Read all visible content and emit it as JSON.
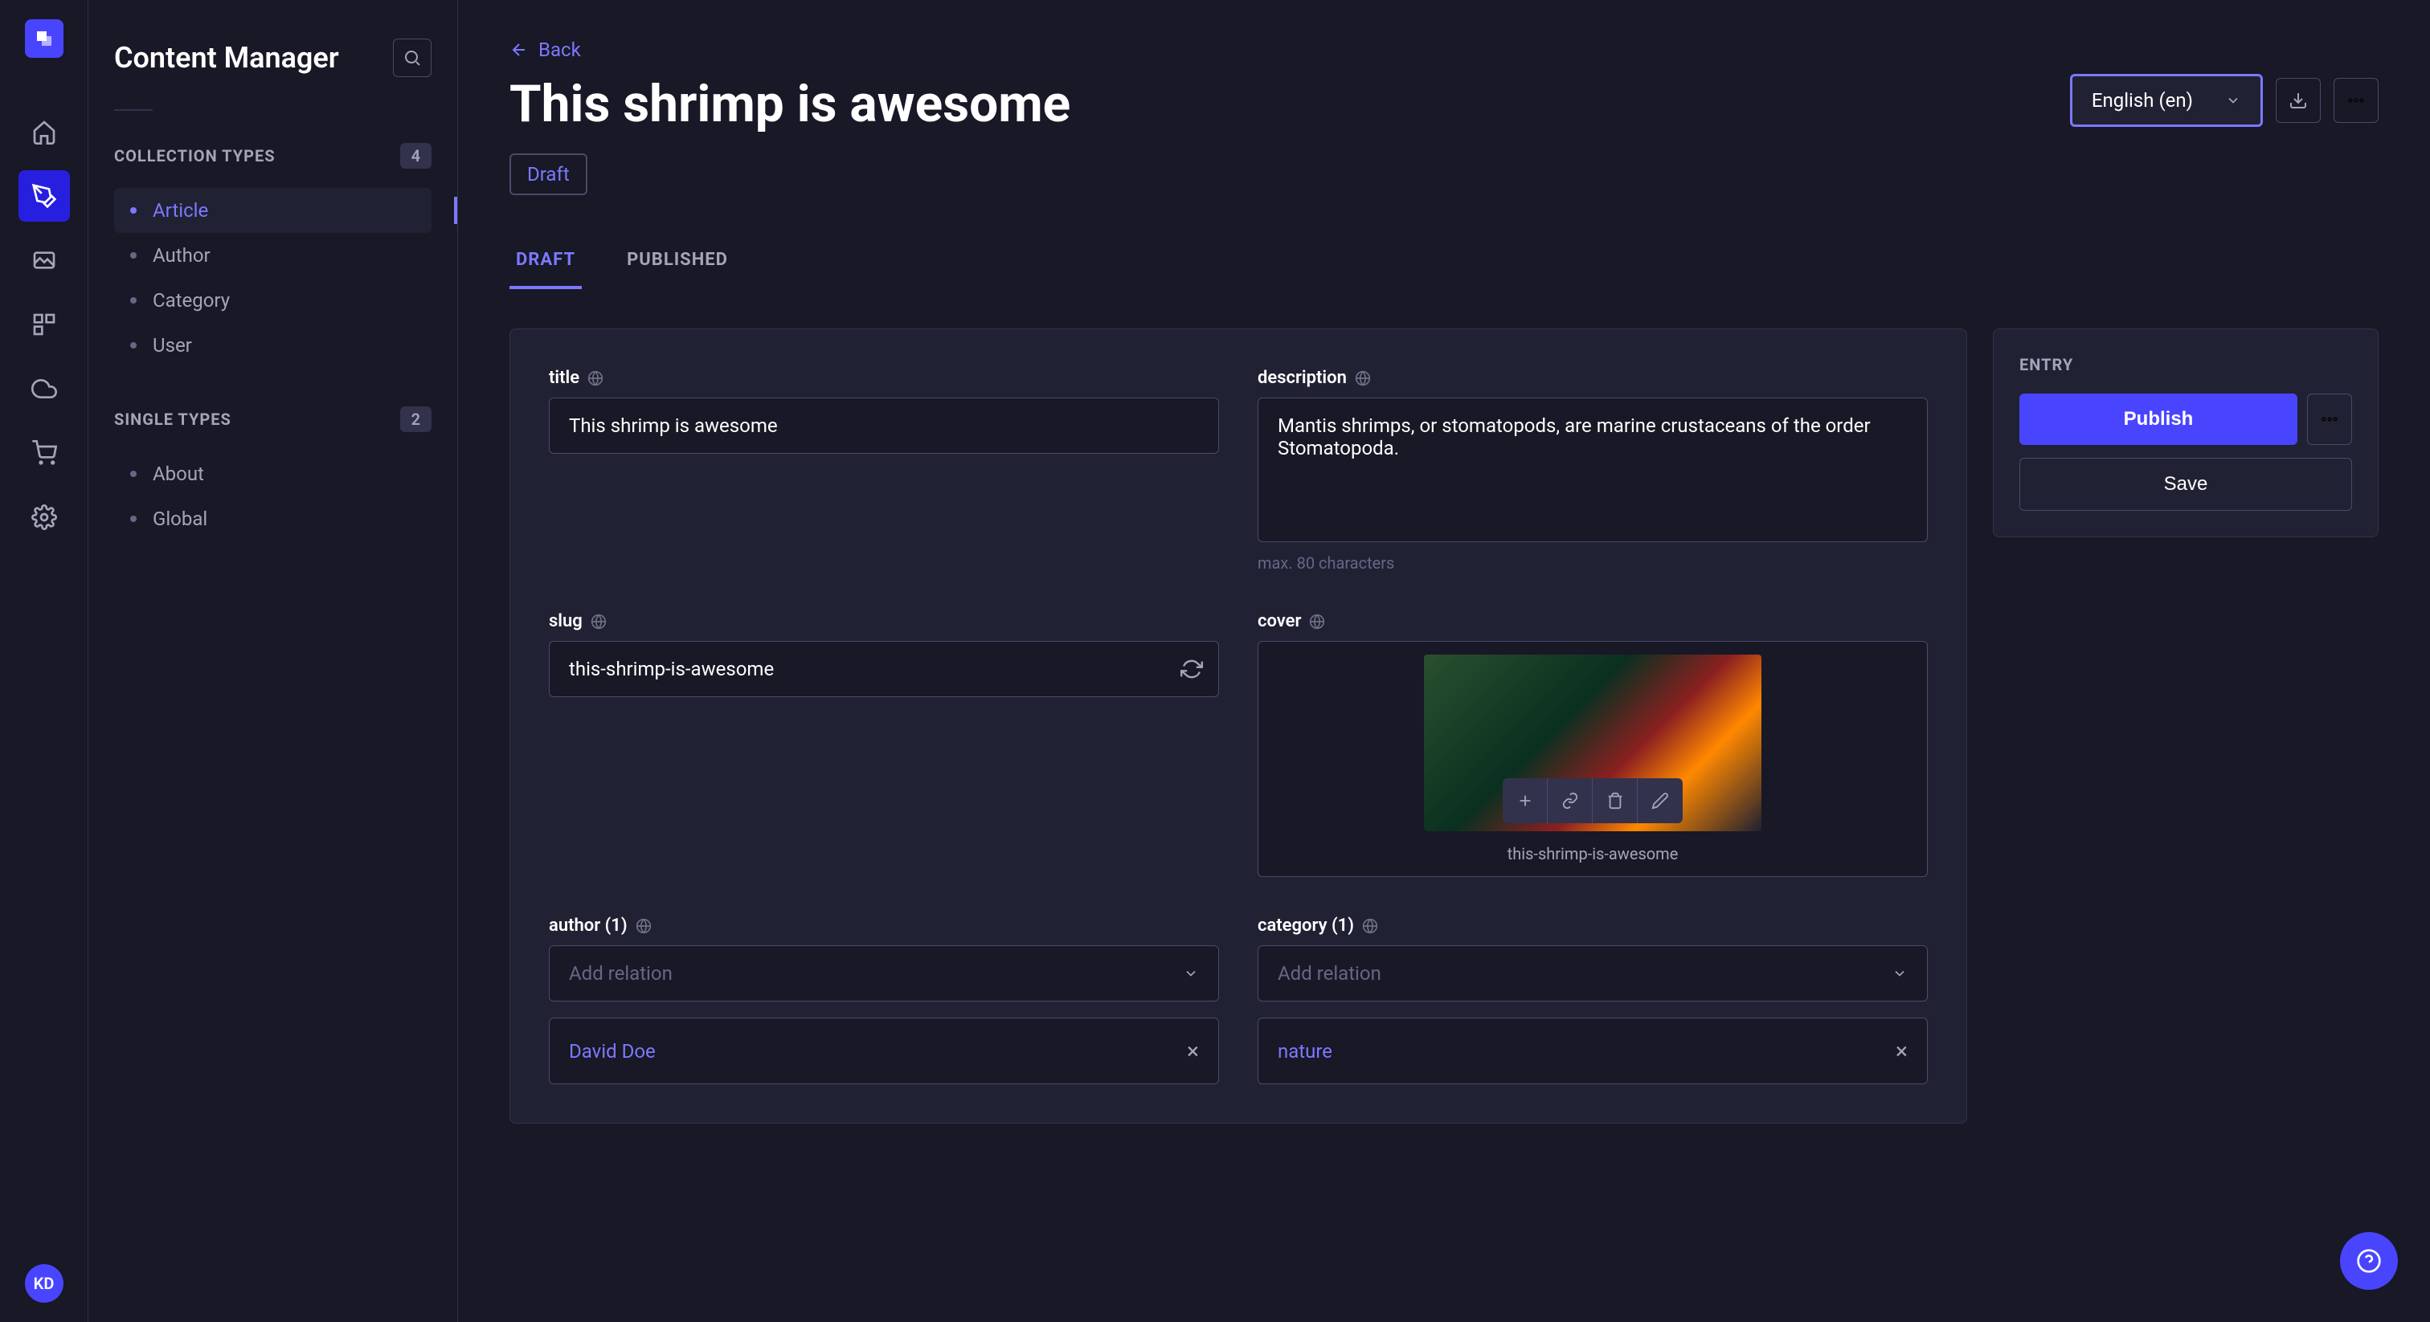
{
  "rail": {
    "avatar_initials": "KD"
  },
  "sidebar": {
    "title": "Content Manager",
    "section1_label": "Collection Types",
    "section1_count": "4",
    "section2_label": "Single Types",
    "section2_count": "2",
    "collection_items": [
      "Article",
      "Author",
      "Category",
      "User"
    ],
    "single_items": [
      "About",
      "Global"
    ]
  },
  "header": {
    "back_label": "Back",
    "page_title": "This shrimp is awesome",
    "locale_label": "English (en)",
    "status_badge": "Draft"
  },
  "tabs": {
    "draft": "Draft",
    "published": "Published"
  },
  "fields": {
    "title_label": "title",
    "title_value": "This shrimp is awesome",
    "description_label": "description",
    "description_value": "Mantis shrimps, or stomatopods, are marine crustaceans of the order Stomatopoda.",
    "description_hint": "max. 80 characters",
    "slug_label": "slug",
    "slug_value": "this-shrimp-is-awesome",
    "cover_label": "cover",
    "cover_caption": "this-shrimp-is-awesome",
    "author_label": "author (1)",
    "category_label": "category (1)",
    "relation_placeholder": "Add relation",
    "author_value": "David Doe",
    "category_value": "nature"
  },
  "panel": {
    "label": "Entry",
    "publish_label": "Publish",
    "save_label": "Save"
  }
}
